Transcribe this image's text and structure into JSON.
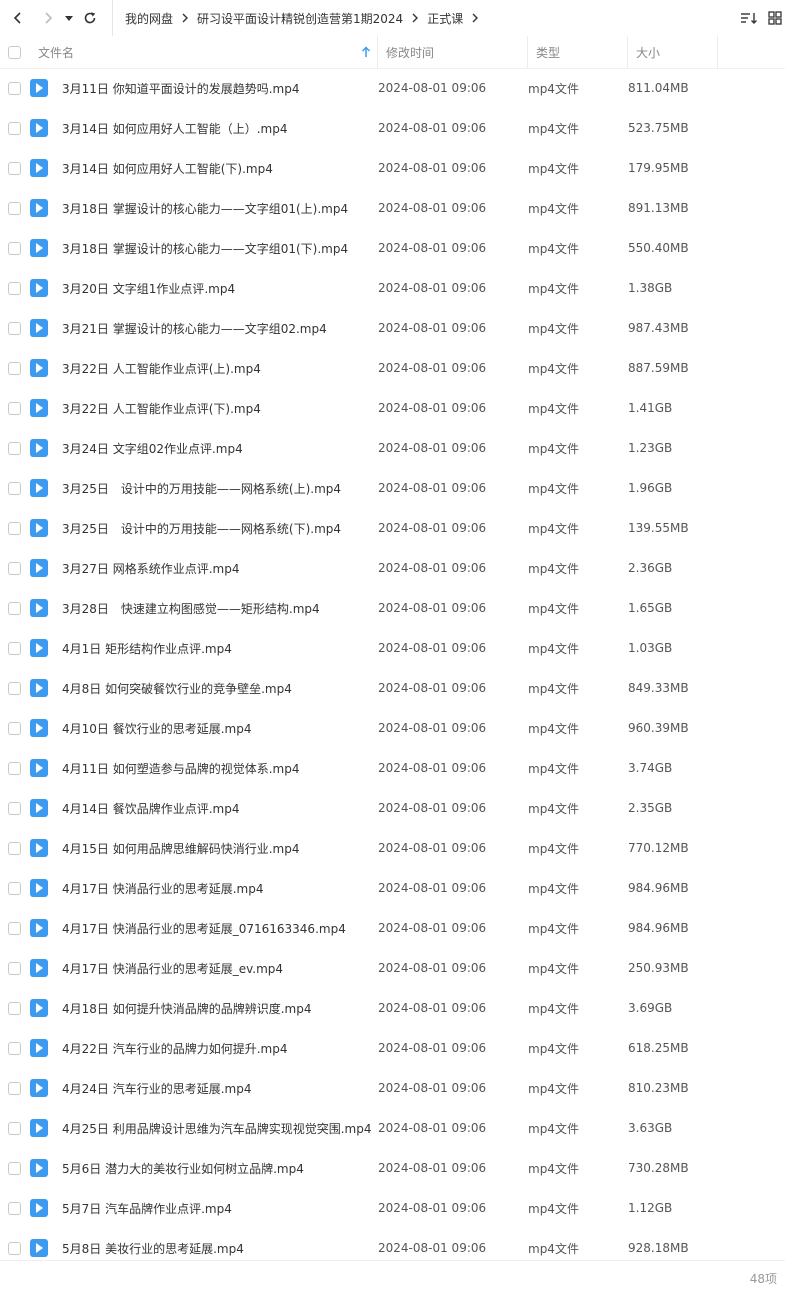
{
  "toolbar": {
    "breadcrumb": [
      "我的网盘",
      "研习设平面设计精锐创造营第1期2024",
      "正式课"
    ]
  },
  "header": {
    "name": "文件名",
    "modified": "修改时间",
    "type": "类型",
    "size": "大小"
  },
  "rows": [
    {
      "name": "3月11日 你知道平面设计的发展趋势吗.mp4",
      "time": "2024-08-01 09:06",
      "type": "mp4文件",
      "size": "811.04MB"
    },
    {
      "name": "3月14日 如何应用好人工智能（上）.mp4",
      "time": "2024-08-01 09:06",
      "type": "mp4文件",
      "size": "523.75MB"
    },
    {
      "name": "3月14日 如何应用好人工智能(下).mp4",
      "time": "2024-08-01 09:06",
      "type": "mp4文件",
      "size": "179.95MB"
    },
    {
      "name": "3月18日 掌握设计的核心能力——文字组01(上).mp4",
      "time": "2024-08-01 09:06",
      "type": "mp4文件",
      "size": "891.13MB"
    },
    {
      "name": "3月18日 掌握设计的核心能力——文字组01(下).mp4",
      "time": "2024-08-01 09:06",
      "type": "mp4文件",
      "size": "550.40MB"
    },
    {
      "name": "3月20日 文字组1作业点评.mp4",
      "time": "2024-08-01 09:06",
      "type": "mp4文件",
      "size": "1.38GB"
    },
    {
      "name": "3月21日 掌握设计的核心能力——文字组02.mp4",
      "time": "2024-08-01 09:06",
      "type": "mp4文件",
      "size": "987.43MB"
    },
    {
      "name": "3月22日 人工智能作业点评(上).mp4",
      "time": "2024-08-01 09:06",
      "type": "mp4文件",
      "size": "887.59MB"
    },
    {
      "name": "3月22日 人工智能作业点评(下).mp4",
      "time": "2024-08-01 09:06",
      "type": "mp4文件",
      "size": "1.41GB"
    },
    {
      "name": "3月24日 文字组02作业点评.mp4",
      "time": "2024-08-01 09:06",
      "type": "mp4文件",
      "size": "1.23GB"
    },
    {
      "name": "3月25日　设计中的万用技能——网格系统(上).mp4",
      "time": "2024-08-01 09:06",
      "type": "mp4文件",
      "size": "1.96GB"
    },
    {
      "name": "3月25日　设计中的万用技能——网格系统(下).mp4",
      "time": "2024-08-01 09:06",
      "type": "mp4文件",
      "size": "139.55MB"
    },
    {
      "name": "3月27日 网格系统作业点评.mp4",
      "time": "2024-08-01 09:06",
      "type": "mp4文件",
      "size": "2.36GB"
    },
    {
      "name": "3月28日　快速建立构图感觉——矩形结构.mp4",
      "time": "2024-08-01 09:06",
      "type": "mp4文件",
      "size": "1.65GB"
    },
    {
      "name": "4月1日 矩形结构作业点评.mp4",
      "time": "2024-08-01 09:06",
      "type": "mp4文件",
      "size": "1.03GB"
    },
    {
      "name": "4月8日 如何突破餐饮行业的竞争壁垒.mp4",
      "time": "2024-08-01 09:06",
      "type": "mp4文件",
      "size": "849.33MB"
    },
    {
      "name": "4月10日 餐饮行业的思考延展.mp4",
      "time": "2024-08-01 09:06",
      "type": "mp4文件",
      "size": "960.39MB"
    },
    {
      "name": "4月11日 如何塑造参与品牌的视觉体系.mp4",
      "time": "2024-08-01 09:06",
      "type": "mp4文件",
      "size": "3.74GB"
    },
    {
      "name": "4月14日 餐饮品牌作业点评.mp4",
      "time": "2024-08-01 09:06",
      "type": "mp4文件",
      "size": "2.35GB"
    },
    {
      "name": "4月15日 如何用品牌思维解码快消行业.mp4",
      "time": "2024-08-01 09:06",
      "type": "mp4文件",
      "size": "770.12MB"
    },
    {
      "name": "4月17日 快消品行业的思考延展.mp4",
      "time": "2024-08-01 09:06",
      "type": "mp4文件",
      "size": "984.96MB"
    },
    {
      "name": "4月17日 快消品行业的思考延展_0716163346.mp4",
      "time": "2024-08-01 09:06",
      "type": "mp4文件",
      "size": "984.96MB"
    },
    {
      "name": "4月17日 快消品行业的思考延展_ev.mp4",
      "time": "2024-08-01 09:06",
      "type": "mp4文件",
      "size": "250.93MB"
    },
    {
      "name": "4月18日 如何提升快消品牌的品牌辨识度.mp4",
      "time": "2024-08-01 09:06",
      "type": "mp4文件",
      "size": "3.69GB"
    },
    {
      "name": "4月22日 汽车行业的品牌力如何提升.mp4",
      "time": "2024-08-01 09:06",
      "type": "mp4文件",
      "size": "618.25MB"
    },
    {
      "name": "4月24日 汽车行业的思考延展.mp4",
      "time": "2024-08-01 09:06",
      "type": "mp4文件",
      "size": "810.23MB"
    },
    {
      "name": "4月25日 利用品牌设计思维为汽车品牌实现视觉突围.mp4",
      "time": "2024-08-01 09:06",
      "type": "mp4文件",
      "size": "3.63GB"
    },
    {
      "name": "5月6日 潜力大的美妆行业如何树立品牌.mp4",
      "time": "2024-08-01 09:06",
      "type": "mp4文件",
      "size": "730.28MB"
    },
    {
      "name": "5月7日 汽车品牌作业点评.mp4",
      "time": "2024-08-01 09:06",
      "type": "mp4文件",
      "size": "1.12GB"
    },
    {
      "name": "5月8日 美妆行业的思考延展.mp4",
      "time": "2024-08-01 09:06",
      "type": "mp4文件",
      "size": "928.18MB"
    }
  ],
  "footer": {
    "count": "48项"
  },
  "icons": {
    "file": "video-file-icon",
    "accent": "#3c9bf0"
  }
}
